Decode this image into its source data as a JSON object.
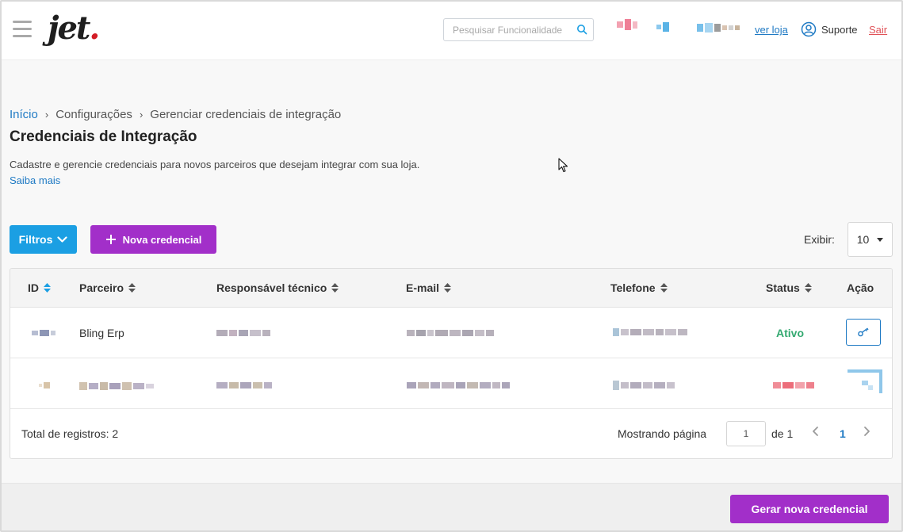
{
  "header": {
    "logo_text": "jet",
    "logo_dot": ".",
    "search_placeholder": "Pesquisar Funcionalidade",
    "ver_loja": "ver loja",
    "suporte": "Suporte",
    "sair": "Sair",
    "icons": [
      "menu-icon",
      "search-icon",
      "user-circle-icon"
    ]
  },
  "breadcrumb": {
    "items": [
      "Início",
      "Configurações",
      "Gerenciar credenciais de integração"
    ],
    "separator": "›"
  },
  "page": {
    "title": "Credenciais de Integração",
    "description": "Cadastre e gerencie credenciais para novos parceiros que desejam integrar com sua loja.",
    "saiba_mais": "Saiba mais"
  },
  "toolbar": {
    "filtros": "Filtros",
    "nova_credencial": "Nova credencial",
    "exibir_label": "Exibir:",
    "exibir_value": "10"
  },
  "table": {
    "columns": [
      "ID",
      "Parceiro",
      "Responsável técnico",
      "E-mail",
      "Telefone",
      "Status",
      "Ação"
    ],
    "rows": [
      {
        "parceiro": "Bling Erp",
        "status": "Ativo"
      },
      {
        "parceiro": "",
        "status": ""
      }
    ],
    "total_label": "Total de registros: 2",
    "mostrando": "Mostrando página",
    "page_input": "1",
    "de": "de 1",
    "current_page": "1"
  },
  "footer": {
    "gerar": "Gerar nova credencial"
  },
  "colors": {
    "primary_blue": "#1b9fe3",
    "purple": "#a22fc9",
    "link": "#1f7ac4",
    "active_green": "#33a970",
    "logout_red": "#e05258"
  }
}
